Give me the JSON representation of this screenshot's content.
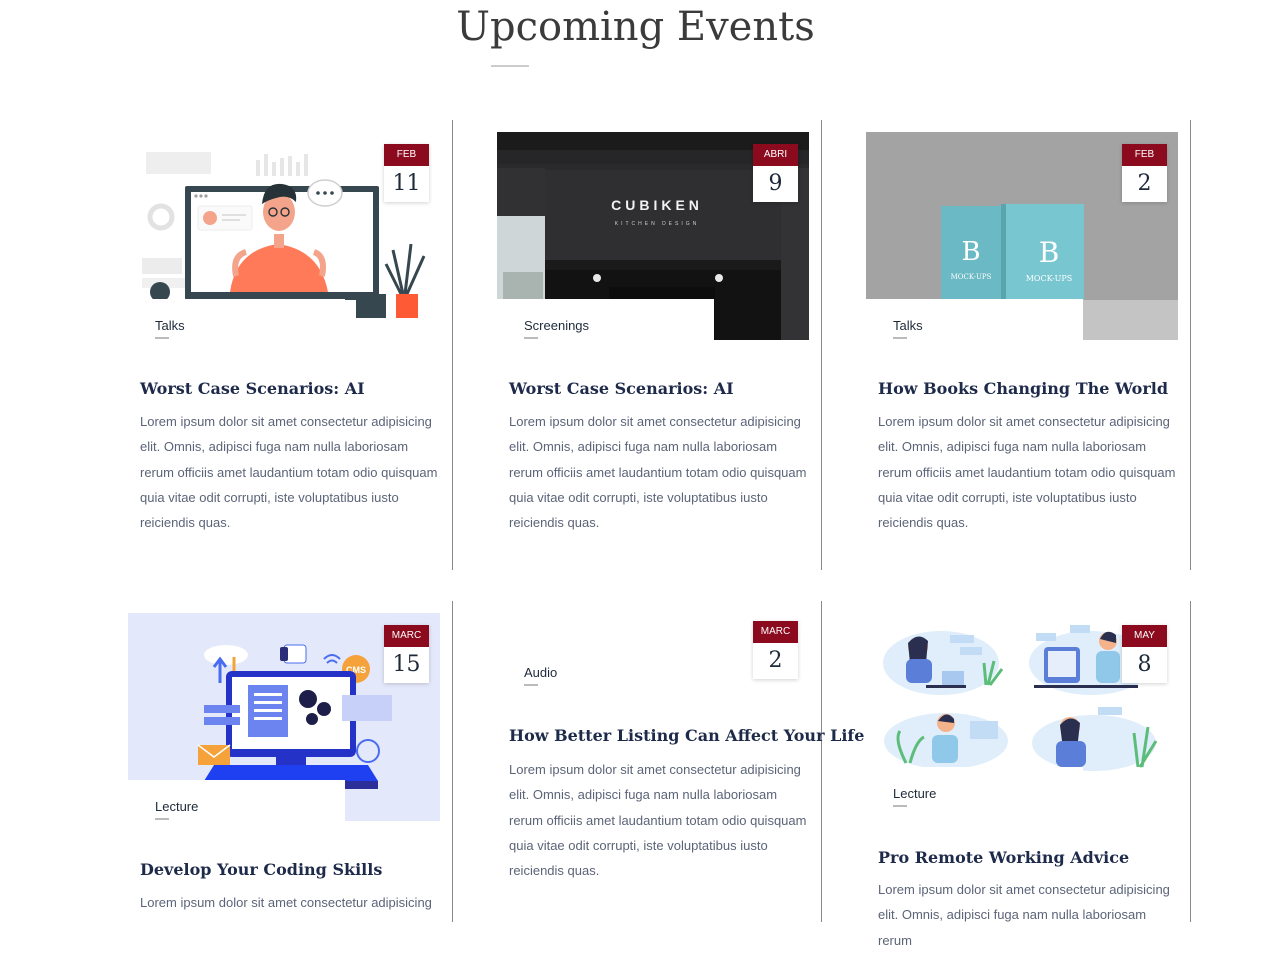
{
  "page": {
    "title": "Upcoming Events"
  },
  "events": [
    {
      "month": "FEB",
      "day": "11",
      "category": "Talks",
      "title": "Worst Case Scenarios: AI",
      "excerpt": "Lorem ipsum dolor sit amet consectetur adipisicing elit. Omnis, adipisci fuga nam nulla laboriosam rerum officiis amet laudantium totam odio quisquam quia vitae odit corrupti, iste voluptatibus iusto reiciendis quas."
    },
    {
      "month": "ABRI",
      "day": "9",
      "category": "Screenings",
      "title": "Worst Case Scenarios: AI",
      "excerpt": "Lorem ipsum dolor sit amet consectetur adipisicing elit. Omnis, adipisci fuga nam nulla laboriosam rerum officiis amet laudantium totam odio quisquam quia vitae odit corrupti, iste voluptatibus iusto reiciendis quas.",
      "sign_line1": "CUBIKEN",
      "sign_line2": "KITCHEN DESIGN"
    },
    {
      "month": "FEB",
      "day": "2",
      "category": "Talks",
      "title": "How Books Changing The World",
      "excerpt": "Lorem ipsum dolor sit amet consectetur adipisicing elit. Omnis, adipisci fuga nam nulla laboriosam rerum officiis amet laudantium totam odio quisquam quia vitae odit corrupti, iste voluptatibus iusto reiciendis quas.",
      "book_letter": "B",
      "book_text": "MOCK-UPS"
    },
    {
      "month": "MARC",
      "day": "15",
      "category": "Lecture",
      "title": "Develop Your Coding Skills",
      "excerpt": "Lorem ipsum dolor sit amet consectetur adipisicing",
      "badge": "CMS"
    },
    {
      "month": "MARC",
      "day": "2",
      "category": "Audio",
      "title": "How Better Listing Can Affect Your Life",
      "excerpt": "Lorem ipsum dolor sit amet consectetur adipisicing elit. Omnis, adipisci fuga nam nulla laboriosam rerum officiis amet laudantium totam odio quisquam quia vitae odit corrupti, iste voluptatibus iusto reiciendis quas."
    },
    {
      "month": "MAY",
      "day": "8",
      "category": "Lecture",
      "title": "Pro Remote Working Advice",
      "excerpt": "Lorem ipsum dolor sit amet consectetur adipisicing elit. Omnis, adipisci fuga nam nulla laboriosam rerum"
    }
  ],
  "colors": {
    "accent": "#8b0a1e",
    "heading": "#1e2a4a",
    "text": "#5b6478"
  }
}
